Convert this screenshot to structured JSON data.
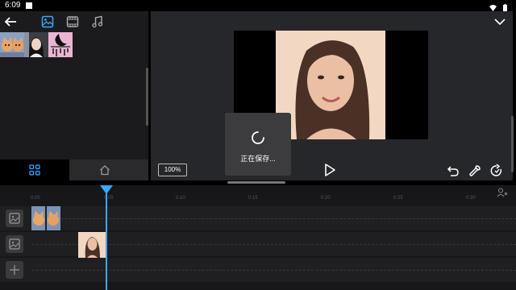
{
  "status_bar": {
    "time": "6:09"
  },
  "preview": {
    "zoom_label": "100%"
  },
  "saving_dialog": {
    "text": "正在保存..."
  },
  "timeline": {
    "ruler_marks": [
      "0:00",
      "0:05",
      "0:10",
      "0:15",
      "0:20",
      "0:25",
      "0:30"
    ]
  },
  "colors": {
    "accent": "#3aa7ff",
    "panel": "#26272a",
    "dialog": "#3c3c3e"
  }
}
